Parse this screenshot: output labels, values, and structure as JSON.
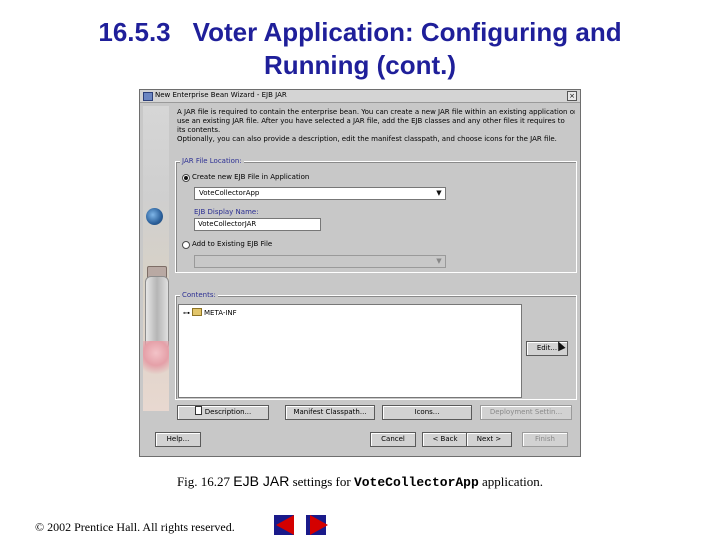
{
  "slide": {
    "title_number": "16.5.3",
    "title_line1": "Voter Application: Configuring and",
    "title_line2": "Running (cont.)"
  },
  "window": {
    "title": "New Enterprise Bean Wizard - EJB JAR",
    "close_glyph": "×",
    "intro_lines": [
      "A JAR file is required to contain the enterprise bean. You can create a new JAR file within an existing application or",
      "use an existing JAR file. After you have selected a JAR file, add the EJB classes and any other files it requires to",
      "its contents.",
      "Optionally, you can also provide a description, edit the manifest classpath, and choose icons for the JAR file."
    ],
    "location_group": {
      "legend": "JAR File Location:",
      "create_new_label": "Create new EJB File in Application",
      "create_new_selected": true,
      "application_value": "VoteCollectorApp",
      "display_name_label": "EJB Display Name:",
      "display_name_value": "VoteCollectorJAR",
      "add_existing_label": "Add to Existing EJB File",
      "add_existing_value": ""
    },
    "contents_group": {
      "legend": "Contents:",
      "tree_item": "META-INF",
      "edit_button": "Edit..."
    },
    "action_buttons": {
      "description": "Description...",
      "manifest": "Manifest Classpath...",
      "icons": "Icons...",
      "deployment": "Deployment Settin..."
    },
    "nav_buttons": {
      "help": "Help...",
      "cancel": "Cancel",
      "back": "< Back",
      "next": "Next >",
      "finish": "Finish"
    }
  },
  "caption": {
    "prefix": "Fig. 16.27",
    "sans_part": "EJB JAR",
    "middle": "settings for",
    "code": "VoteCollectorApp",
    "suffix": "application."
  },
  "footer": {
    "copyright": "© 2002 Prentice Hall.  All rights reserved."
  },
  "colors": {
    "title": "#1f1f9a",
    "nav_arrows": "#d40000",
    "legend_text": "#2c2f93",
    "window_bg": "#c8c8c8"
  }
}
